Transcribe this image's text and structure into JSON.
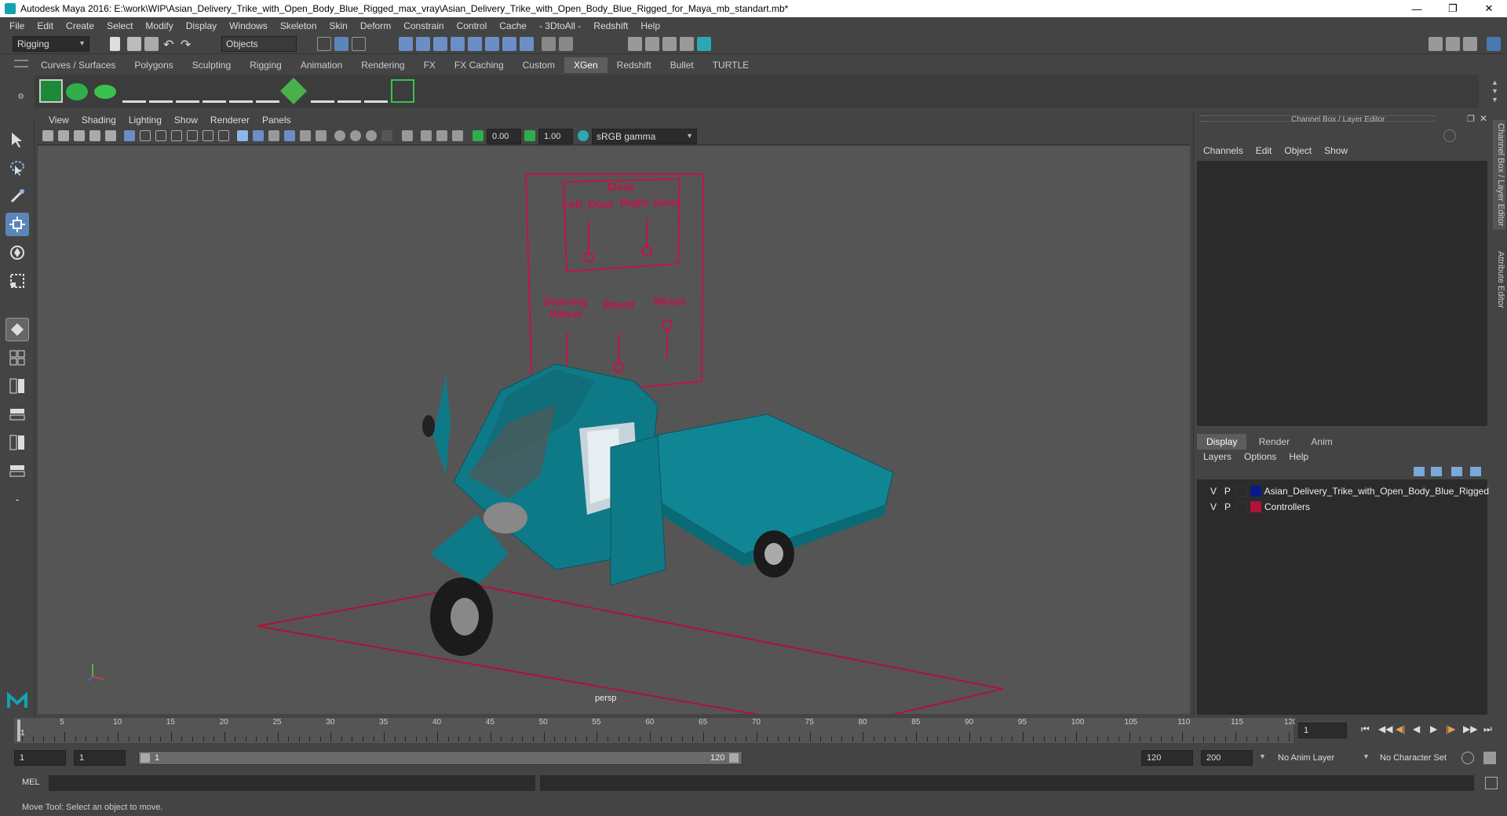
{
  "window": {
    "title": "Autodesk Maya 2016: E:\\work\\WIP\\Asian_Delivery_Trike_with_Open_Body_Blue_Rigged_max_vray\\Asian_Delivery_Trike_with_Open_Body_Blue_Rigged_for_Maya_mb_standart.mb*"
  },
  "menubar": [
    "File",
    "Edit",
    "Create",
    "Select",
    "Modify",
    "Display",
    "Windows",
    "Skeleton",
    "Skin",
    "Deform",
    "Constrain",
    "Control",
    "Cache",
    "- 3DtoAll -",
    "Redshift",
    "Help"
  ],
  "status": {
    "menuset": "Rigging",
    "selection_mode": "Objects"
  },
  "shelf_tabs": [
    "Curves / Surfaces",
    "Polygons",
    "Sculpting",
    "Rigging",
    "Animation",
    "Rendering",
    "FX",
    "FX Caching",
    "Custom",
    "XGen",
    "Redshift",
    "Bullet",
    "TURTLE"
  ],
  "shelf_active": "XGen",
  "viewport": {
    "menu": [
      "View",
      "Shading",
      "Lighting",
      "Show",
      "Renderer",
      "Panels"
    ],
    "exposure": "0.00",
    "gamma": "1.00",
    "color_space": "sRGB gamma",
    "camera_label": "persp"
  },
  "controls_board": {
    "door": "Door",
    "left_door": "Left_Door",
    "right_door": "Right_Door",
    "steering": "Steering",
    "steering2": "Wheel",
    "board": "Board",
    "wheel": "Wheel"
  },
  "channel_box": {
    "title": "Channel Box / Layer Editor",
    "menu": [
      "Channels",
      "Edit",
      "Object",
      "Show"
    ]
  },
  "layer_editor": {
    "tabs": [
      "Display",
      "Render",
      "Anim"
    ],
    "menu": [
      "Layers",
      "Options",
      "Help"
    ],
    "layers": [
      {
        "v": "V",
        "p": "P",
        "color": "#0a1a8a",
        "name": "Asian_Delivery_Trike_with_Open_Body_Blue_Rigged"
      },
      {
        "v": "V",
        "p": "P",
        "color": "#b0123a",
        "name": "Controllers"
      }
    ]
  },
  "side_tabs": [
    "Channel Box / Layer Editor",
    "Attribute Editor"
  ],
  "timeline": {
    "ticks": [
      "5",
      "10",
      "15",
      "20",
      "25",
      "30",
      "35",
      "40",
      "45",
      "50",
      "55",
      "60",
      "65",
      "70",
      "75",
      "80",
      "85",
      "90",
      "95",
      "100",
      "105",
      "110",
      "115",
      "120"
    ],
    "first": "1",
    "current_frame": "1"
  },
  "range": {
    "start": "1",
    "anim_start": "1",
    "range_start": "1",
    "range_end": "120",
    "anim_end": "120",
    "end": "200",
    "anim_layer": "No Anim Layer",
    "char_set": "No Character Set"
  },
  "cmdline": {
    "label": "MEL"
  },
  "helpline": {
    "text": "Move Tool: Select an object to move."
  },
  "colors": {
    "accent": "#5b86b8",
    "trike": "#0e7a88",
    "controls": "#b0123a"
  }
}
